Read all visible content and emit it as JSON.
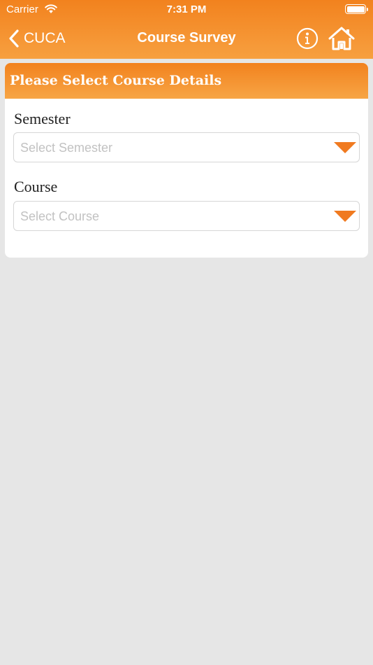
{
  "status_bar": {
    "carrier": "Carrier",
    "time": "7:31 PM"
  },
  "nav": {
    "back_label": "CUCA",
    "title": "Course Survey",
    "info_icon": "info-icon",
    "home_icon": "home-icon"
  },
  "card": {
    "header": "Please Select Course Details",
    "semester_label": "Semester",
    "semester_placeholder": "Select Semester",
    "course_label": "Course",
    "course_placeholder": "Select Course"
  },
  "colors": {
    "accent": "#f2821e",
    "background": "#e6e6e6"
  }
}
